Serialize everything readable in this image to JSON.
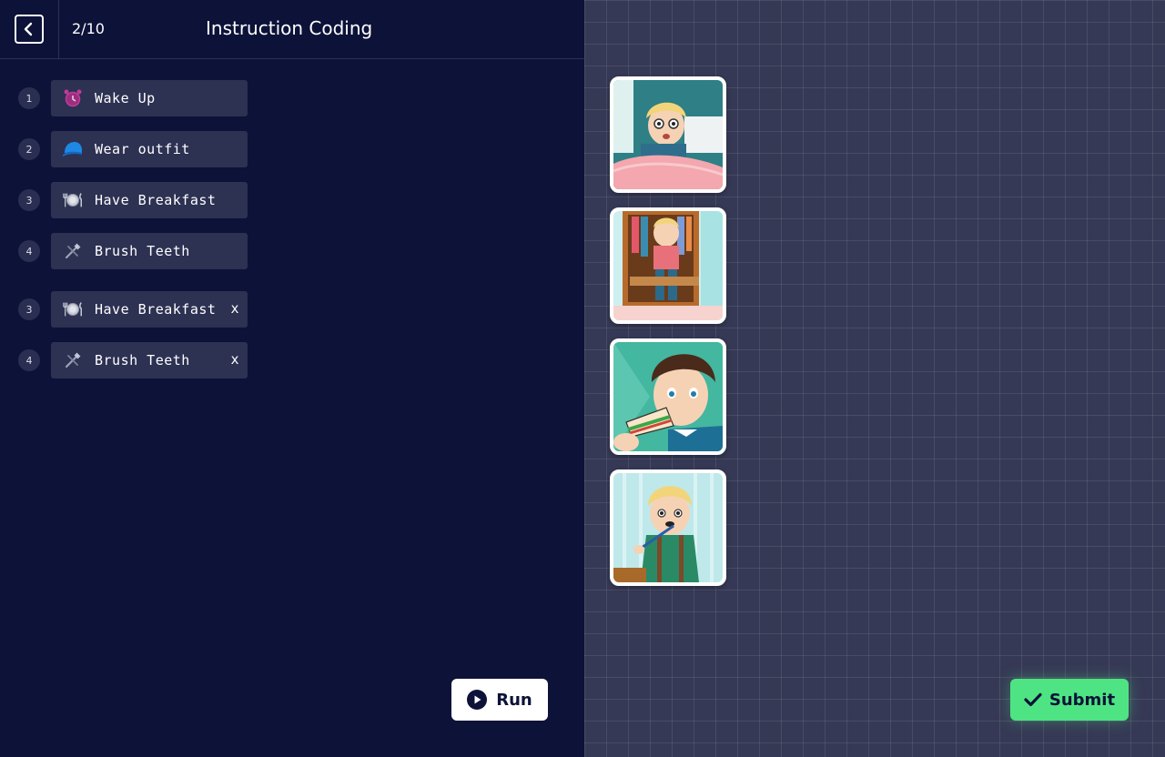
{
  "header": {
    "back_icon": "chevron-left-icon",
    "progress": "2/10",
    "title": "Instruction Coding"
  },
  "steps": [
    {
      "number": "1",
      "label": "Wake Up",
      "icon": "alarm-clock-icon",
      "removable": false
    },
    {
      "number": "2",
      "label": "Wear outfit",
      "icon": "cap-icon",
      "removable": false
    },
    {
      "number": "3",
      "label": "Have Breakfast",
      "icon": "plate-cutlery-icon",
      "removable": false
    },
    {
      "number": "4",
      "label": "Brush Teeth",
      "icon": "toothbrush-icon",
      "removable": false
    },
    {
      "number": "3",
      "label": "Have Breakfast",
      "icon": "plate-cutlery-icon",
      "removable": true,
      "remove_label": "x"
    },
    {
      "number": "4",
      "label": "Brush Teeth",
      "icon": "toothbrush-icon",
      "removable": true,
      "remove_label": "x"
    }
  ],
  "run_button": {
    "label": "Run",
    "icon": "play-icon"
  },
  "submit_button": {
    "label": "Submit",
    "icon": "checkmark-icon"
  },
  "pictures": [
    {
      "name": "boy-waking-up-picture"
    },
    {
      "name": "boy-wearing-outfit-picture"
    },
    {
      "name": "boy-eating-sandwich-picture"
    },
    {
      "name": "boy-brushing-teeth-picture"
    }
  ],
  "colors": {
    "left_bg": "#0c1238",
    "right_bg": "#363955",
    "card_bg": "#2d3152",
    "submit_green": "#4ee483"
  }
}
